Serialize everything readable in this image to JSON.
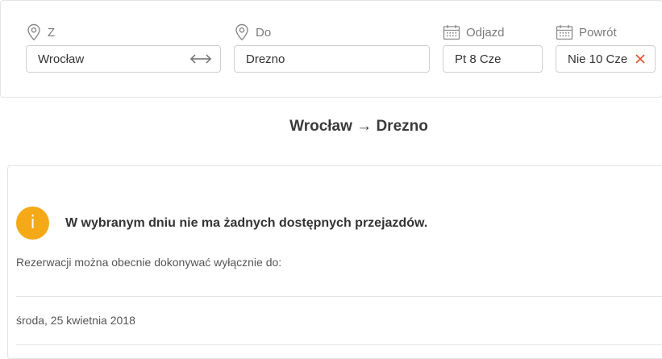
{
  "search": {
    "from": {
      "label": "Z",
      "value": "Wrocław",
      "icon": "map-pin-icon"
    },
    "to": {
      "label": "Do",
      "value": "Drezno",
      "icon": "map-pin-icon"
    },
    "departure": {
      "label": "Odjazd",
      "value": "Pt 8 Cze",
      "icon": "calendar-icon"
    },
    "return": {
      "label": "Powrót",
      "value": "Nie 10 Cze",
      "icon": "calendar-icon"
    },
    "swap_icon": "swap-arrows-icon",
    "clear_icon": "close-icon"
  },
  "route_title": "Wrocław → Drezno",
  "notice": {
    "icon_glyph": "i",
    "title": "W wybranym dniu nie ma żadnych dostępnych przejazdów.",
    "subtitle": "Rezerwacji można obecnie dokonywać wyłącznie do:",
    "date": "środa, 25 kwietnia 2018"
  },
  "colors": {
    "accent": "#f5a916",
    "clear": "#e0522b",
    "border": "#cfcfcf",
    "label": "#7a7a7a"
  }
}
